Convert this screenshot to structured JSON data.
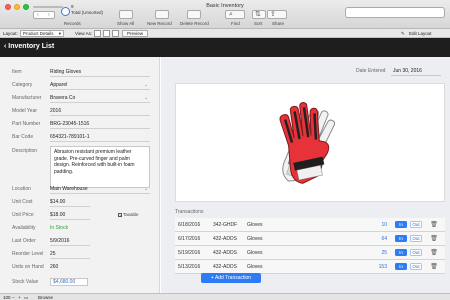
{
  "window": {
    "title": "Basic Inventory"
  },
  "toolbar": {
    "record_number": "6",
    "record_count": "9",
    "record_total": "Total (Unsorted)",
    "records_label": "Records",
    "show_all_label": "Show All",
    "new_record_label": "New Record",
    "delete_record_label": "Delete Record",
    "find_label": "Find",
    "sort_label": "Sort",
    "share_label": "Share"
  },
  "layoutbar": {
    "layout_label": "Layout:",
    "layout_value": "Product Details",
    "view_as_label": "View As:",
    "preview_label": "Preview",
    "edit_layout_label": "Edit Layout"
  },
  "header": {
    "back_label": "Inventory List"
  },
  "details": {
    "item_label": "Item",
    "item_value": "Riding Gloves",
    "category_label": "Category",
    "category_value": "Apparel",
    "manufacturer_label": "Manufacturer",
    "manufacturer_value": "Bravera Co",
    "model_year_label": "Model Year",
    "model_year_value": "2016",
    "part_number_label": "Part Number",
    "part_number_value": "BRG-23045-1516",
    "bar_code_label": "Bar Code",
    "bar_code_value": "654321-789101-1",
    "description_label": "Description",
    "description_value": "Abrasion resistant premium leather grade. Pre-curved finger and palm design. Reinforced with built-in foam padding.",
    "location_label": "Location",
    "location_value": "Main Warehouse",
    "unit_cost_label": "Unit Cost",
    "unit_cost_value": "$14.00",
    "unit_price_label": "Unit Price",
    "unit_price_value": "$18.00",
    "taxable_label": "Taxable",
    "availability_label": "Availability",
    "availability_value": "In Stock",
    "last_order_label": "Last Order",
    "last_order_value": "5/9/2016",
    "reorder_level_label": "Reorder Level",
    "reorder_level_value": "25",
    "units_on_hand_label": "Units on Hand",
    "units_on_hand_value": "260",
    "stock_value_label": "Stock Value",
    "stock_value_value": "$4,680.00"
  },
  "right": {
    "date_entered_label": "Date Entered",
    "date_entered_value": "Jun 30, 2016",
    "transactions_label": "Transactions",
    "add_transaction_label": "+ Add Transaction",
    "transactions": [
      {
        "date": "6/18/2016",
        "code": "342-GHDF",
        "item": "Gloves",
        "qty": "10",
        "in": "In",
        "out": "Out"
      },
      {
        "date": "6/17/2016",
        "code": "432-ADDS",
        "item": "Gloves",
        "qty": "64",
        "in": "In",
        "out": "Out"
      },
      {
        "date": "5/19/2016",
        "code": "432-ADDS",
        "item": "Gloves",
        "qty": "25",
        "in": "In",
        "out": "Out"
      },
      {
        "date": "5/13/2016",
        "code": "432-ADDS",
        "item": "Gloves",
        "qty": "153",
        "in": "In",
        "out": "Out"
      }
    ]
  },
  "status": {
    "zoom": "100",
    "mode": "Browse"
  },
  "colors": {
    "accent": "#2d7cf6",
    "header": "#1e1e1e",
    "in_stock": "#2e9e3e",
    "glove_red": "#e8323a"
  }
}
